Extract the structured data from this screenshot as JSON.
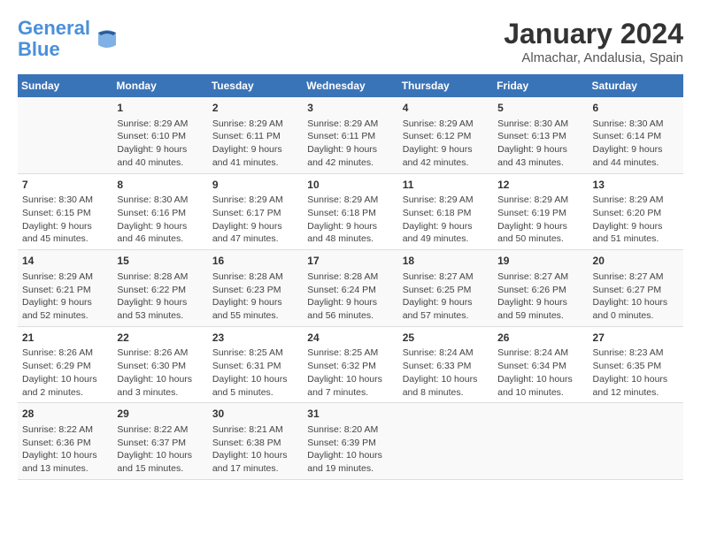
{
  "header": {
    "logo_line1": "General",
    "logo_line2": "Blue",
    "month": "January 2024",
    "location": "Almachar, Andalusia, Spain"
  },
  "weekdays": [
    "Sunday",
    "Monday",
    "Tuesday",
    "Wednesday",
    "Thursday",
    "Friday",
    "Saturday"
  ],
  "weeks": [
    [
      {
        "day": "",
        "info": ""
      },
      {
        "day": "1",
        "info": "Sunrise: 8:29 AM\nSunset: 6:10 PM\nDaylight: 9 hours\nand 40 minutes."
      },
      {
        "day": "2",
        "info": "Sunrise: 8:29 AM\nSunset: 6:11 PM\nDaylight: 9 hours\nand 41 minutes."
      },
      {
        "day": "3",
        "info": "Sunrise: 8:29 AM\nSunset: 6:11 PM\nDaylight: 9 hours\nand 42 minutes."
      },
      {
        "day": "4",
        "info": "Sunrise: 8:29 AM\nSunset: 6:12 PM\nDaylight: 9 hours\nand 42 minutes."
      },
      {
        "day": "5",
        "info": "Sunrise: 8:30 AM\nSunset: 6:13 PM\nDaylight: 9 hours\nand 43 minutes."
      },
      {
        "day": "6",
        "info": "Sunrise: 8:30 AM\nSunset: 6:14 PM\nDaylight: 9 hours\nand 44 minutes."
      }
    ],
    [
      {
        "day": "7",
        "info": "Sunrise: 8:30 AM\nSunset: 6:15 PM\nDaylight: 9 hours\nand 45 minutes."
      },
      {
        "day": "8",
        "info": "Sunrise: 8:30 AM\nSunset: 6:16 PM\nDaylight: 9 hours\nand 46 minutes."
      },
      {
        "day": "9",
        "info": "Sunrise: 8:29 AM\nSunset: 6:17 PM\nDaylight: 9 hours\nand 47 minutes."
      },
      {
        "day": "10",
        "info": "Sunrise: 8:29 AM\nSunset: 6:18 PM\nDaylight: 9 hours\nand 48 minutes."
      },
      {
        "day": "11",
        "info": "Sunrise: 8:29 AM\nSunset: 6:18 PM\nDaylight: 9 hours\nand 49 minutes."
      },
      {
        "day": "12",
        "info": "Sunrise: 8:29 AM\nSunset: 6:19 PM\nDaylight: 9 hours\nand 50 minutes."
      },
      {
        "day": "13",
        "info": "Sunrise: 8:29 AM\nSunset: 6:20 PM\nDaylight: 9 hours\nand 51 minutes."
      }
    ],
    [
      {
        "day": "14",
        "info": "Sunrise: 8:29 AM\nSunset: 6:21 PM\nDaylight: 9 hours\nand 52 minutes."
      },
      {
        "day": "15",
        "info": "Sunrise: 8:28 AM\nSunset: 6:22 PM\nDaylight: 9 hours\nand 53 minutes."
      },
      {
        "day": "16",
        "info": "Sunrise: 8:28 AM\nSunset: 6:23 PM\nDaylight: 9 hours\nand 55 minutes."
      },
      {
        "day": "17",
        "info": "Sunrise: 8:28 AM\nSunset: 6:24 PM\nDaylight: 9 hours\nand 56 minutes."
      },
      {
        "day": "18",
        "info": "Sunrise: 8:27 AM\nSunset: 6:25 PM\nDaylight: 9 hours\nand 57 minutes."
      },
      {
        "day": "19",
        "info": "Sunrise: 8:27 AM\nSunset: 6:26 PM\nDaylight: 9 hours\nand 59 minutes."
      },
      {
        "day": "20",
        "info": "Sunrise: 8:27 AM\nSunset: 6:27 PM\nDaylight: 10 hours\nand 0 minutes."
      }
    ],
    [
      {
        "day": "21",
        "info": "Sunrise: 8:26 AM\nSunset: 6:29 PM\nDaylight: 10 hours\nand 2 minutes."
      },
      {
        "day": "22",
        "info": "Sunrise: 8:26 AM\nSunset: 6:30 PM\nDaylight: 10 hours\nand 3 minutes."
      },
      {
        "day": "23",
        "info": "Sunrise: 8:25 AM\nSunset: 6:31 PM\nDaylight: 10 hours\nand 5 minutes."
      },
      {
        "day": "24",
        "info": "Sunrise: 8:25 AM\nSunset: 6:32 PM\nDaylight: 10 hours\nand 7 minutes."
      },
      {
        "day": "25",
        "info": "Sunrise: 8:24 AM\nSunset: 6:33 PM\nDaylight: 10 hours\nand 8 minutes."
      },
      {
        "day": "26",
        "info": "Sunrise: 8:24 AM\nSunset: 6:34 PM\nDaylight: 10 hours\nand 10 minutes."
      },
      {
        "day": "27",
        "info": "Sunrise: 8:23 AM\nSunset: 6:35 PM\nDaylight: 10 hours\nand 12 minutes."
      }
    ],
    [
      {
        "day": "28",
        "info": "Sunrise: 8:22 AM\nSunset: 6:36 PM\nDaylight: 10 hours\nand 13 minutes."
      },
      {
        "day": "29",
        "info": "Sunrise: 8:22 AM\nSunset: 6:37 PM\nDaylight: 10 hours\nand 15 minutes."
      },
      {
        "day": "30",
        "info": "Sunrise: 8:21 AM\nSunset: 6:38 PM\nDaylight: 10 hours\nand 17 minutes."
      },
      {
        "day": "31",
        "info": "Sunrise: 8:20 AM\nSunset: 6:39 PM\nDaylight: 10 hours\nand 19 minutes."
      },
      {
        "day": "",
        "info": ""
      },
      {
        "day": "",
        "info": ""
      },
      {
        "day": "",
        "info": ""
      }
    ]
  ]
}
